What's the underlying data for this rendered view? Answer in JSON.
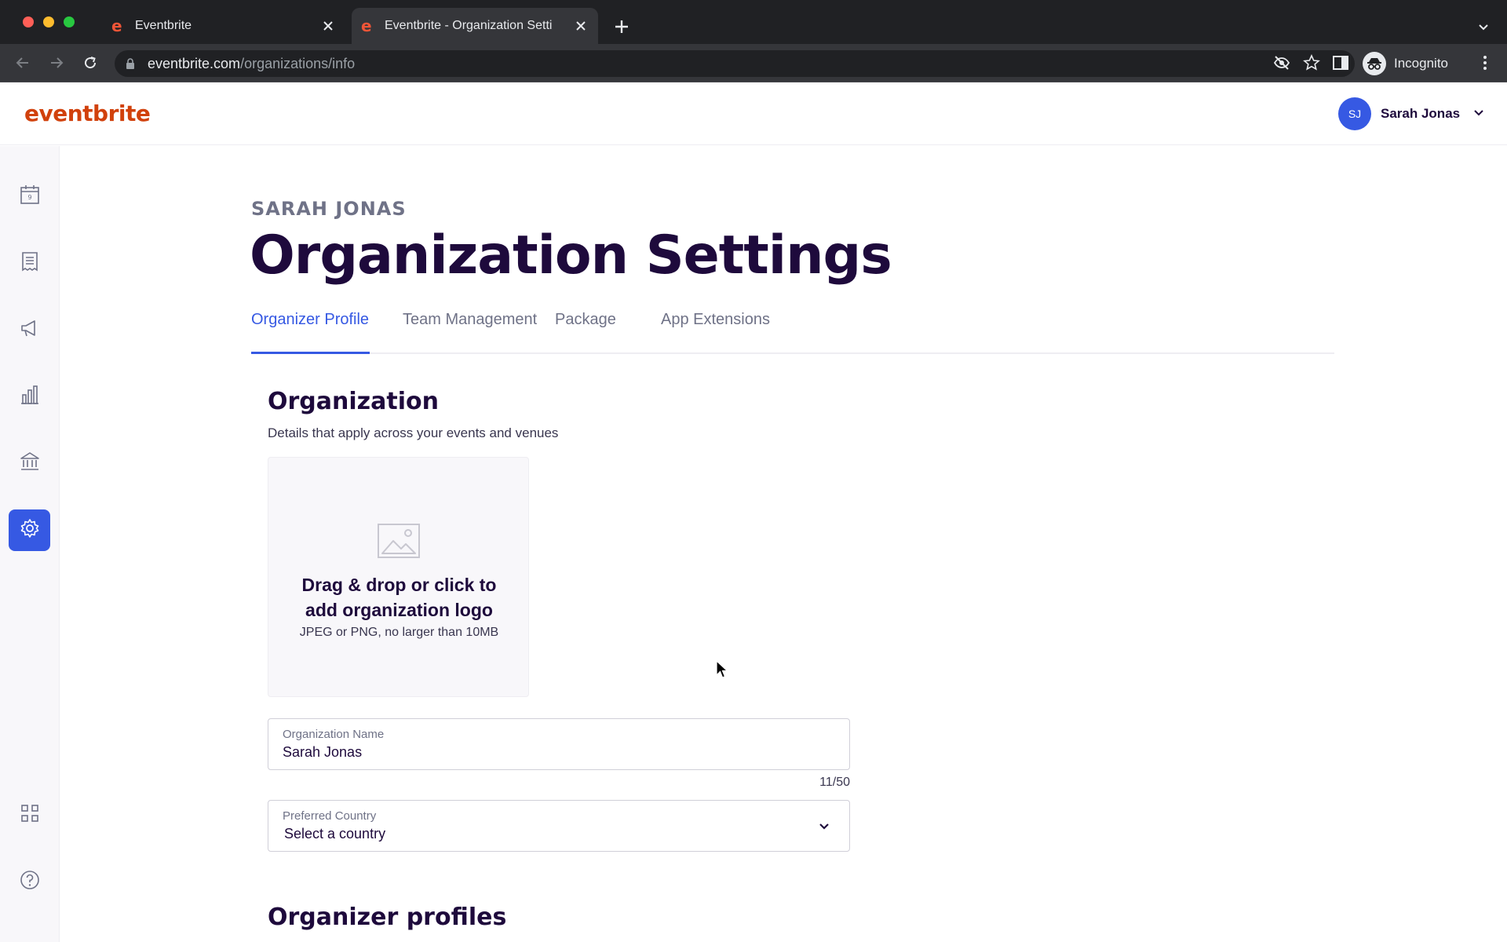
{
  "browser": {
    "tabs": [
      {
        "title": "Eventbrite",
        "active": false
      },
      {
        "title": "Eventbrite - Organization Setti",
        "active": true
      }
    ],
    "url_domain": "eventbrite.com",
    "url_path": "/organizations/info",
    "profile_label": "Incognito"
  },
  "header": {
    "logo_text": "eventbrite",
    "user_initials": "SJ",
    "user_name": "Sarah Jonas"
  },
  "sidebar": {
    "items": [
      {
        "icon": "calendar-icon"
      },
      {
        "icon": "orders-receipt-icon"
      },
      {
        "icon": "marketing-megaphone-icon"
      },
      {
        "icon": "reports-bar-chart-icon"
      },
      {
        "icon": "finance-bank-icon"
      },
      {
        "icon": "settings-gear-icon",
        "active": true
      },
      {
        "icon": "apps-grid-icon"
      },
      {
        "icon": "help-question-icon"
      }
    ]
  },
  "page": {
    "eyebrow": "SARAH JONAS",
    "title": "Organization Settings",
    "tabs": [
      {
        "label": "Organizer Profile",
        "active": true
      },
      {
        "label": "Team Management"
      },
      {
        "label": "Package"
      },
      {
        "label": "App Extensions"
      }
    ]
  },
  "organization": {
    "title": "Organization",
    "description": "Details that apply across your events and venues",
    "logo_upload": {
      "title_line1": "Drag & drop or click to",
      "title_line2": "add organization logo",
      "subtitle": "JPEG or PNG, no larger than 10MB"
    },
    "name_field": {
      "label": "Organization Name",
      "value": "Sarah Jonas",
      "counter": "11/50"
    },
    "country_field": {
      "label": "Preferred Country",
      "value": "Select a country"
    }
  },
  "organizer_profiles": {
    "title": "Organizer profiles"
  },
  "colors": {
    "brand_orange": "#d1410c",
    "accent_blue": "#3659e3",
    "heading_dark": "#1e0a3c"
  }
}
